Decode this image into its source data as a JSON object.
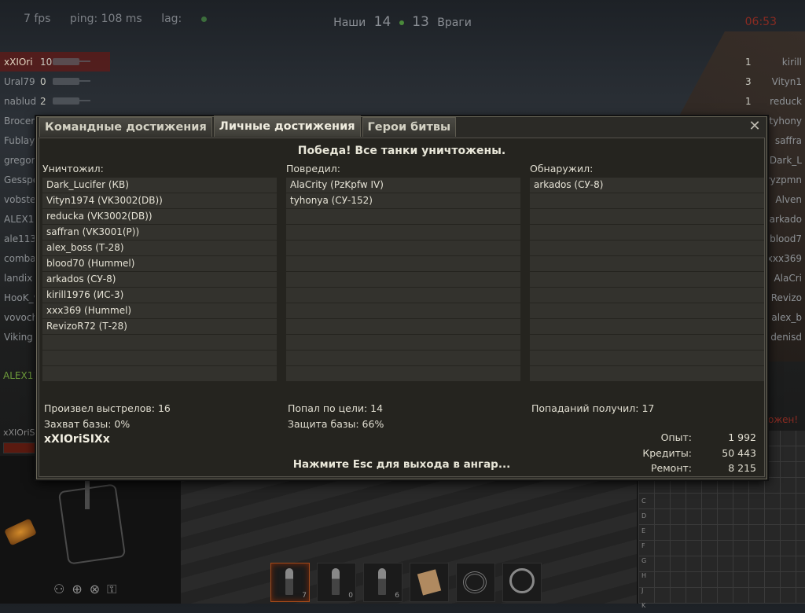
{
  "hud": {
    "fps": "7 fps",
    "ping": "ping: 108 ms",
    "lag": "lag:",
    "ally_label": "Наши",
    "ally_score": "14",
    "enemy_score": "13",
    "enemy_label": "Враги",
    "timer": "06:53"
  },
  "team_left": [
    {
      "name": "xXIOri",
      "frags": "10"
    },
    {
      "name": "Ural79",
      "frags": "0"
    },
    {
      "name": "nablud",
      "frags": "2"
    },
    {
      "name": "Brocer",
      "frags": ""
    },
    {
      "name": "Fublay",
      "frags": ""
    },
    {
      "name": "gregor",
      "frags": ""
    },
    {
      "name": "Gesspe",
      "frags": ""
    },
    {
      "name": "vobste",
      "frags": ""
    },
    {
      "name": "ALEX11",
      "frags": ""
    },
    {
      "name": "ale113",
      "frags": ""
    },
    {
      "name": "combat",
      "frags": ""
    },
    {
      "name": "landix",
      "frags": ""
    },
    {
      "name": "HooK_9",
      "frags": ""
    },
    {
      "name": "vovoch",
      "frags": ""
    },
    {
      "name": "Viking",
      "frags": ""
    }
  ],
  "team_left_highlight": "ALEX11",
  "team_right": [
    {
      "name": "kirill",
      "frags": "1"
    },
    {
      "name": "Vityn1",
      "frags": "3"
    },
    {
      "name": "reduck",
      "frags": "1"
    },
    {
      "name": "tyhony",
      "frags": ""
    },
    {
      "name": "saffra",
      "frags": ""
    },
    {
      "name": "Dark_L",
      "frags": ""
    },
    {
      "name": "ryzpmn",
      "frags": ""
    },
    {
      "name": "Alven",
      "frags": ""
    },
    {
      "name": "arkado",
      "frags": ""
    },
    {
      "name": "blood7",
      "frags": ""
    },
    {
      "name": "xxx369",
      "frags": ""
    },
    {
      "name": "AlaCri",
      "frags": ""
    },
    {
      "name": "Revizo",
      "frags": ""
    },
    {
      "name": "alex_b",
      "frags": ""
    },
    {
      "name": "denisd",
      "frags": ""
    }
  ],
  "overlay_text_right": "тожен!",
  "player_short": "xXIOriSI",
  "minimap_letters": [
    "C",
    "D",
    "E",
    "F",
    "G",
    "H",
    "J",
    "K"
  ],
  "consumables": [
    {
      "icon": "ap-shell-icon",
      "count": "7"
    },
    {
      "icon": "apcr-shell-icon",
      "count": "0"
    },
    {
      "icon": "he-shell-icon",
      "count": "6"
    },
    {
      "icon": "repair-kit-icon",
      "count": ""
    },
    {
      "icon": "first-aid-icon",
      "count": ""
    },
    {
      "icon": "fire-extinguisher-icon",
      "count": ""
    }
  ],
  "dialog": {
    "tabs": [
      "Командные достижения",
      "Личные достижения",
      "Герои битвы"
    ],
    "active_tab": 1,
    "result_title": "Победа! Все танки уничтожены.",
    "columns": [
      {
        "header": "Уничтожил:",
        "entries": [
          "Dark_Lucifer (КВ)",
          "Vityn1974 (VK3002(DB))",
          "reducka (VK3002(DB))",
          "saffran (VK3001(P))",
          "alex_boss (Т-28)",
          "blood70 (Hummel)",
          "arkados (СУ-8)",
          "kirill1976 (ИС-3)",
          "xxx369 (Hummel)",
          "RevizoR72 (Т-28)"
        ]
      },
      {
        "header": "Повредил:",
        "entries": [
          "AlaCrity (PzKpfw IV)",
          "tyhonya (СУ-152)"
        ]
      },
      {
        "header": "Обнаружил:",
        "entries": [
          "arkados (СУ-8)"
        ]
      }
    ],
    "stats": {
      "shots": "Произвел выстрелов: 16",
      "hits": "Попал по цели: 14",
      "hits_received": "Попаданий получил: 17",
      "capture": "Захват базы: 0%",
      "defense": "Защита базы: 66%"
    },
    "username": "xXIOriSIXx",
    "rewards": [
      {
        "label": "Опыт:",
        "value": "1 992"
      },
      {
        "label": "Кредиты:",
        "value": "50 443"
      },
      {
        "label": "Ремонт:",
        "value": "8 215"
      }
    ],
    "esc_hint": "Нажмите Esc для выхода в ангар..."
  }
}
